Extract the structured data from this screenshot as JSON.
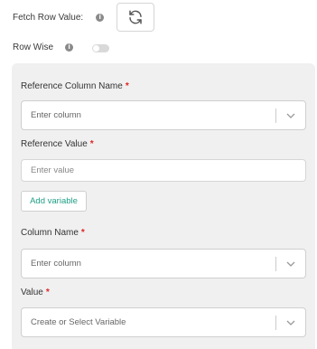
{
  "fetch_row_value": {
    "label": "Fetch Row Value:",
    "info": "i"
  },
  "row_wise": {
    "label": "Row Wise",
    "info": "i",
    "enabled": false
  },
  "reference_column_name": {
    "label": "Reference Column Name",
    "required": "*",
    "placeholder": "Enter column"
  },
  "reference_value": {
    "label": "Reference Value",
    "required": "*",
    "placeholder": "Enter value"
  },
  "add_variable": {
    "label": "Add variable"
  },
  "column_name": {
    "label": "Column Name",
    "required": "*",
    "placeholder": "Enter column"
  },
  "value": {
    "label": "Value",
    "required": "*",
    "placeholder": "Create or Select Variable"
  },
  "colors": {
    "accent": "#1f9e86",
    "required": "#e02424",
    "panel": "#f0f0f0"
  },
  "icons": {
    "refresh": "refresh-icon",
    "info": "info-icon",
    "chevron": "chevron-down-icon"
  }
}
